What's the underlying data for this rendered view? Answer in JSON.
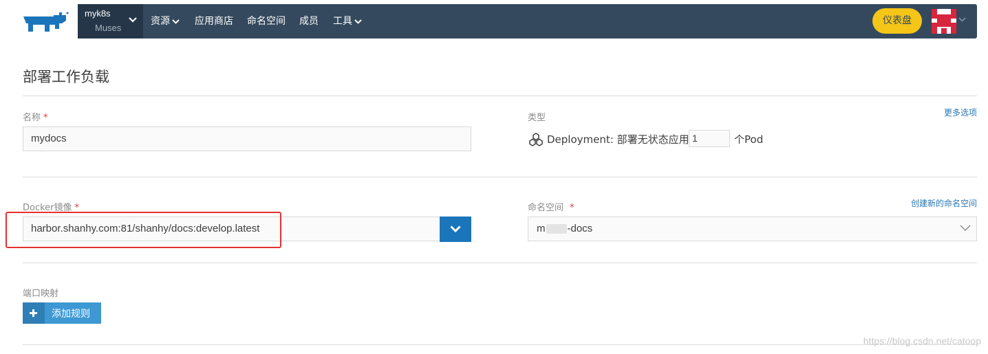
{
  "nav": {
    "cluster_name": "myk8s",
    "cluster_project": "Muses",
    "items": [
      {
        "label": "资源",
        "has_dropdown": true
      },
      {
        "label": "应用商店",
        "has_dropdown": false
      },
      {
        "label": "命名空间",
        "has_dropdown": false
      },
      {
        "label": "成员",
        "has_dropdown": false
      },
      {
        "label": "工具",
        "has_dropdown": true
      }
    ],
    "dashboard_label": "仪表盘"
  },
  "page": {
    "title": "部署工作负载"
  },
  "form": {
    "name_label": "名称",
    "name_value": "mydocs",
    "type_label": "类型",
    "more_options_link": "更多选项",
    "deployment_label": "Deployment: 部署无状态应用",
    "pod_count": "1",
    "pod_suffix": "个Pod",
    "image_label": "Docker镜像",
    "image_value": "harbor.shanhy.com:81/shanhy/docs:develop.latest",
    "namespace_label": "命名空间",
    "create_namespace_link": "创建新的命名空间",
    "namespace_value_prefix": "m",
    "namespace_value_suffix": "-docs",
    "port_label": "端口映射",
    "add_rule_label": "添加规则",
    "required_mark": "*"
  },
  "watermark": "https://blog.csdn.net/catoop",
  "colors": {
    "nav_bg": "#34495e",
    "cluster_bg": "#243648",
    "accent_yellow": "#f5c518",
    "primary_blue": "#1b75bb",
    "button_blue": "#3d98d3",
    "highlight_red": "#e53030"
  }
}
